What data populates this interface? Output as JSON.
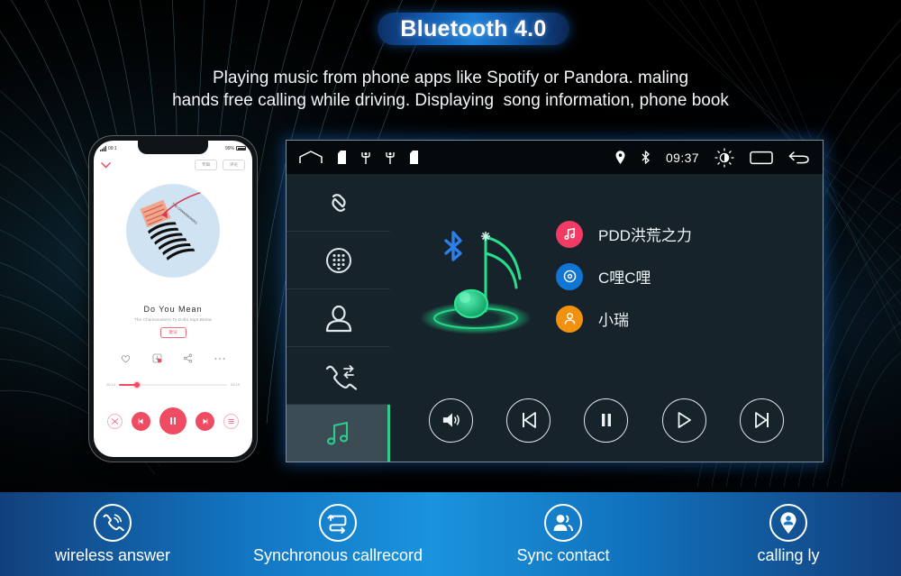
{
  "badge": {
    "label": "Bluetooth 4.0"
  },
  "description": {
    "line1": "Playing music from phone apps like Spotify or Pandora. maling",
    "line2": "hands free calling while driving. Displaying  song information, phone book"
  },
  "phone": {
    "status": {
      "carrier": "09:1",
      "battery": "99%"
    },
    "chips": {
      "left": "专辑",
      "right": "评论"
    },
    "collapse_icon": "chevron-down-icon",
    "song": {
      "title": "Do You Mean",
      "artist": "The Chainsmokers,Ty Dolla Sign,Bülow",
      "tag": "歌词"
    },
    "actions": [
      "heart-icon",
      "download-icon",
      "share-icon",
      "more-icon"
    ],
    "progress": {
      "elapsed": "00:14",
      "total": "03:19",
      "percent": 17
    },
    "controls": [
      "shuffle-icon",
      "previous-icon",
      "pause-icon",
      "next-icon",
      "playlist-icon"
    ]
  },
  "head_unit": {
    "status_bar": {
      "left_icons": [
        "home-icon",
        "sd-card-icon",
        "usb-icon",
        "usb-icon",
        "sd-card-icon"
      ],
      "right_icons": [
        "location-pin-icon",
        "bluetooth-icon"
      ],
      "clock": "09:37",
      "trailing_icons": [
        "brightness-icon",
        "recents-icon",
        "back-icon"
      ]
    },
    "sidebar": [
      {
        "name": "pair-link-icon",
        "label": "Pair",
        "active": false
      },
      {
        "name": "dialpad-icon",
        "label": "Dial",
        "active": false
      },
      {
        "name": "contacts-icon",
        "label": "Contacts",
        "active": false
      },
      {
        "name": "call-record-icon",
        "label": "Call record",
        "active": false
      },
      {
        "name": "music-icon",
        "label": "Music",
        "active": true
      }
    ],
    "hero": {
      "icon": "bluetooth-music-note-icon"
    },
    "playlist": [
      {
        "text": "PDD洪荒之力",
        "icon": "music-note-icon",
        "color": "#f03c64"
      },
      {
        "text": "C哩C哩",
        "icon": "disc-icon",
        "color": "#1076d4"
      },
      {
        "text": "小瑞",
        "icon": "person-icon",
        "color": "#f2900f"
      }
    ],
    "controls": [
      {
        "name": "volume-icon",
        "label": "Volume"
      },
      {
        "name": "previous-icon",
        "label": "Previous"
      },
      {
        "name": "pause-icon",
        "label": "Pause"
      },
      {
        "name": "play-icon",
        "label": "Play"
      },
      {
        "name": "next-icon",
        "label": "Next"
      }
    ]
  },
  "features": [
    {
      "icon": "ringing-phone-icon",
      "label": "wireless answer"
    },
    {
      "icon": "sync-arrows-icon",
      "label": "Synchronous callrecord"
    },
    {
      "icon": "contacts-people-icon",
      "label": "Sync contact"
    },
    {
      "icon": "caller-pin-icon",
      "label": "calling ly"
    }
  ],
  "colors": {
    "accent_green": "#2ecc8a",
    "accent_blue": "#1b93dd",
    "unit_bg": "#16232b",
    "badge_blue": "#1d7fd8"
  }
}
